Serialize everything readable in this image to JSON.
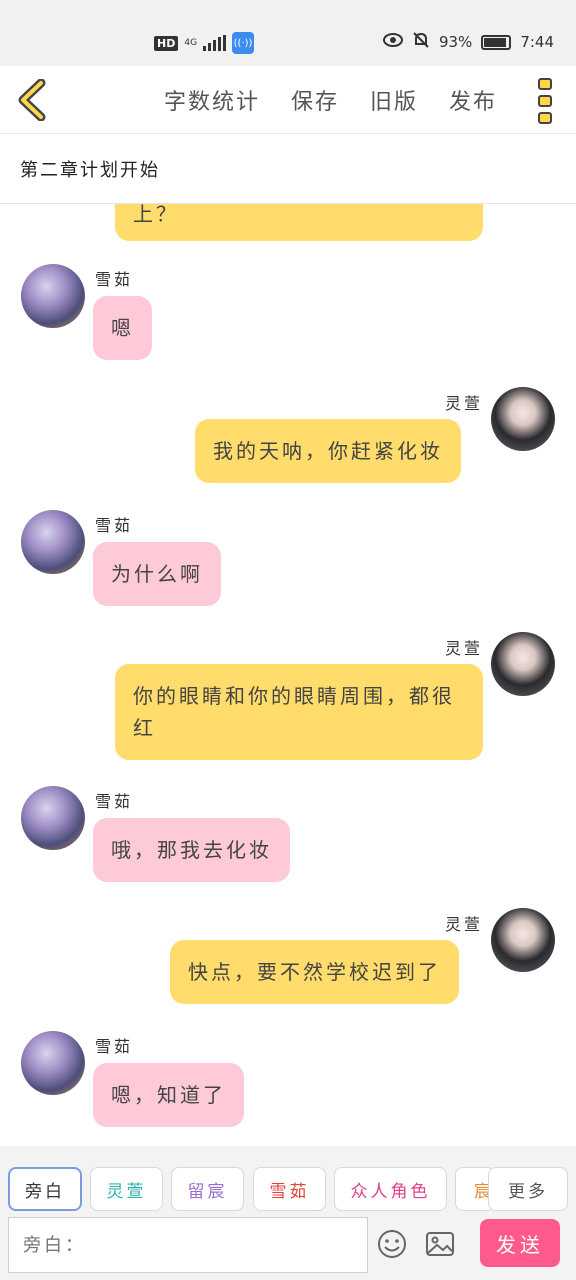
{
  "status_bar": {
    "hd": "HD",
    "network": "4G",
    "battery": "93%",
    "time": "7:44"
  },
  "toolbar": {
    "items": [
      "字数统计",
      "保存",
      "旧版",
      "发布"
    ]
  },
  "chapter": {
    "title": "第二章计划开始"
  },
  "chat": {
    "partial_top": "上？",
    "messages": [
      {
        "speaker": "雪茹",
        "side": "left",
        "text": "嗯"
      },
      {
        "speaker": "灵萱",
        "side": "right",
        "text": "我的天呐，你赶紧化妆"
      },
      {
        "speaker": "雪茹",
        "side": "left",
        "text": "为什么啊"
      },
      {
        "speaker": "灵萱",
        "side": "right",
        "text": "你的眼睛和你的眼睛周围，都很红"
      },
      {
        "speaker": "雪茹",
        "side": "left",
        "text": "哦，那我去化妆"
      },
      {
        "speaker": "灵萱",
        "side": "right",
        "text": "快点，要不然学校迟到了"
      },
      {
        "speaker": "雪茹",
        "side": "left",
        "text": "嗯，知道了"
      }
    ]
  },
  "roles": {
    "items": [
      {
        "label": "旁白",
        "color": "#555555"
      },
      {
        "label": "灵萱",
        "color": "#2fb5a8"
      },
      {
        "label": "留宸",
        "color": "#9a6fd0"
      },
      {
        "label": "雪茹",
        "color": "#e0453a"
      },
      {
        "label": "众人角色",
        "color": "#e2408a"
      },
      {
        "label": "宸",
        "color": "#e88b3a"
      }
    ],
    "more": "更多"
  },
  "input": {
    "placeholder": "旁白：",
    "send": "发送"
  },
  "colors": {
    "accent": "#ffd84a",
    "bubble_right": "#ffdc6b",
    "bubble_left": "#ffcad8",
    "send": "#ff5a8c"
  }
}
